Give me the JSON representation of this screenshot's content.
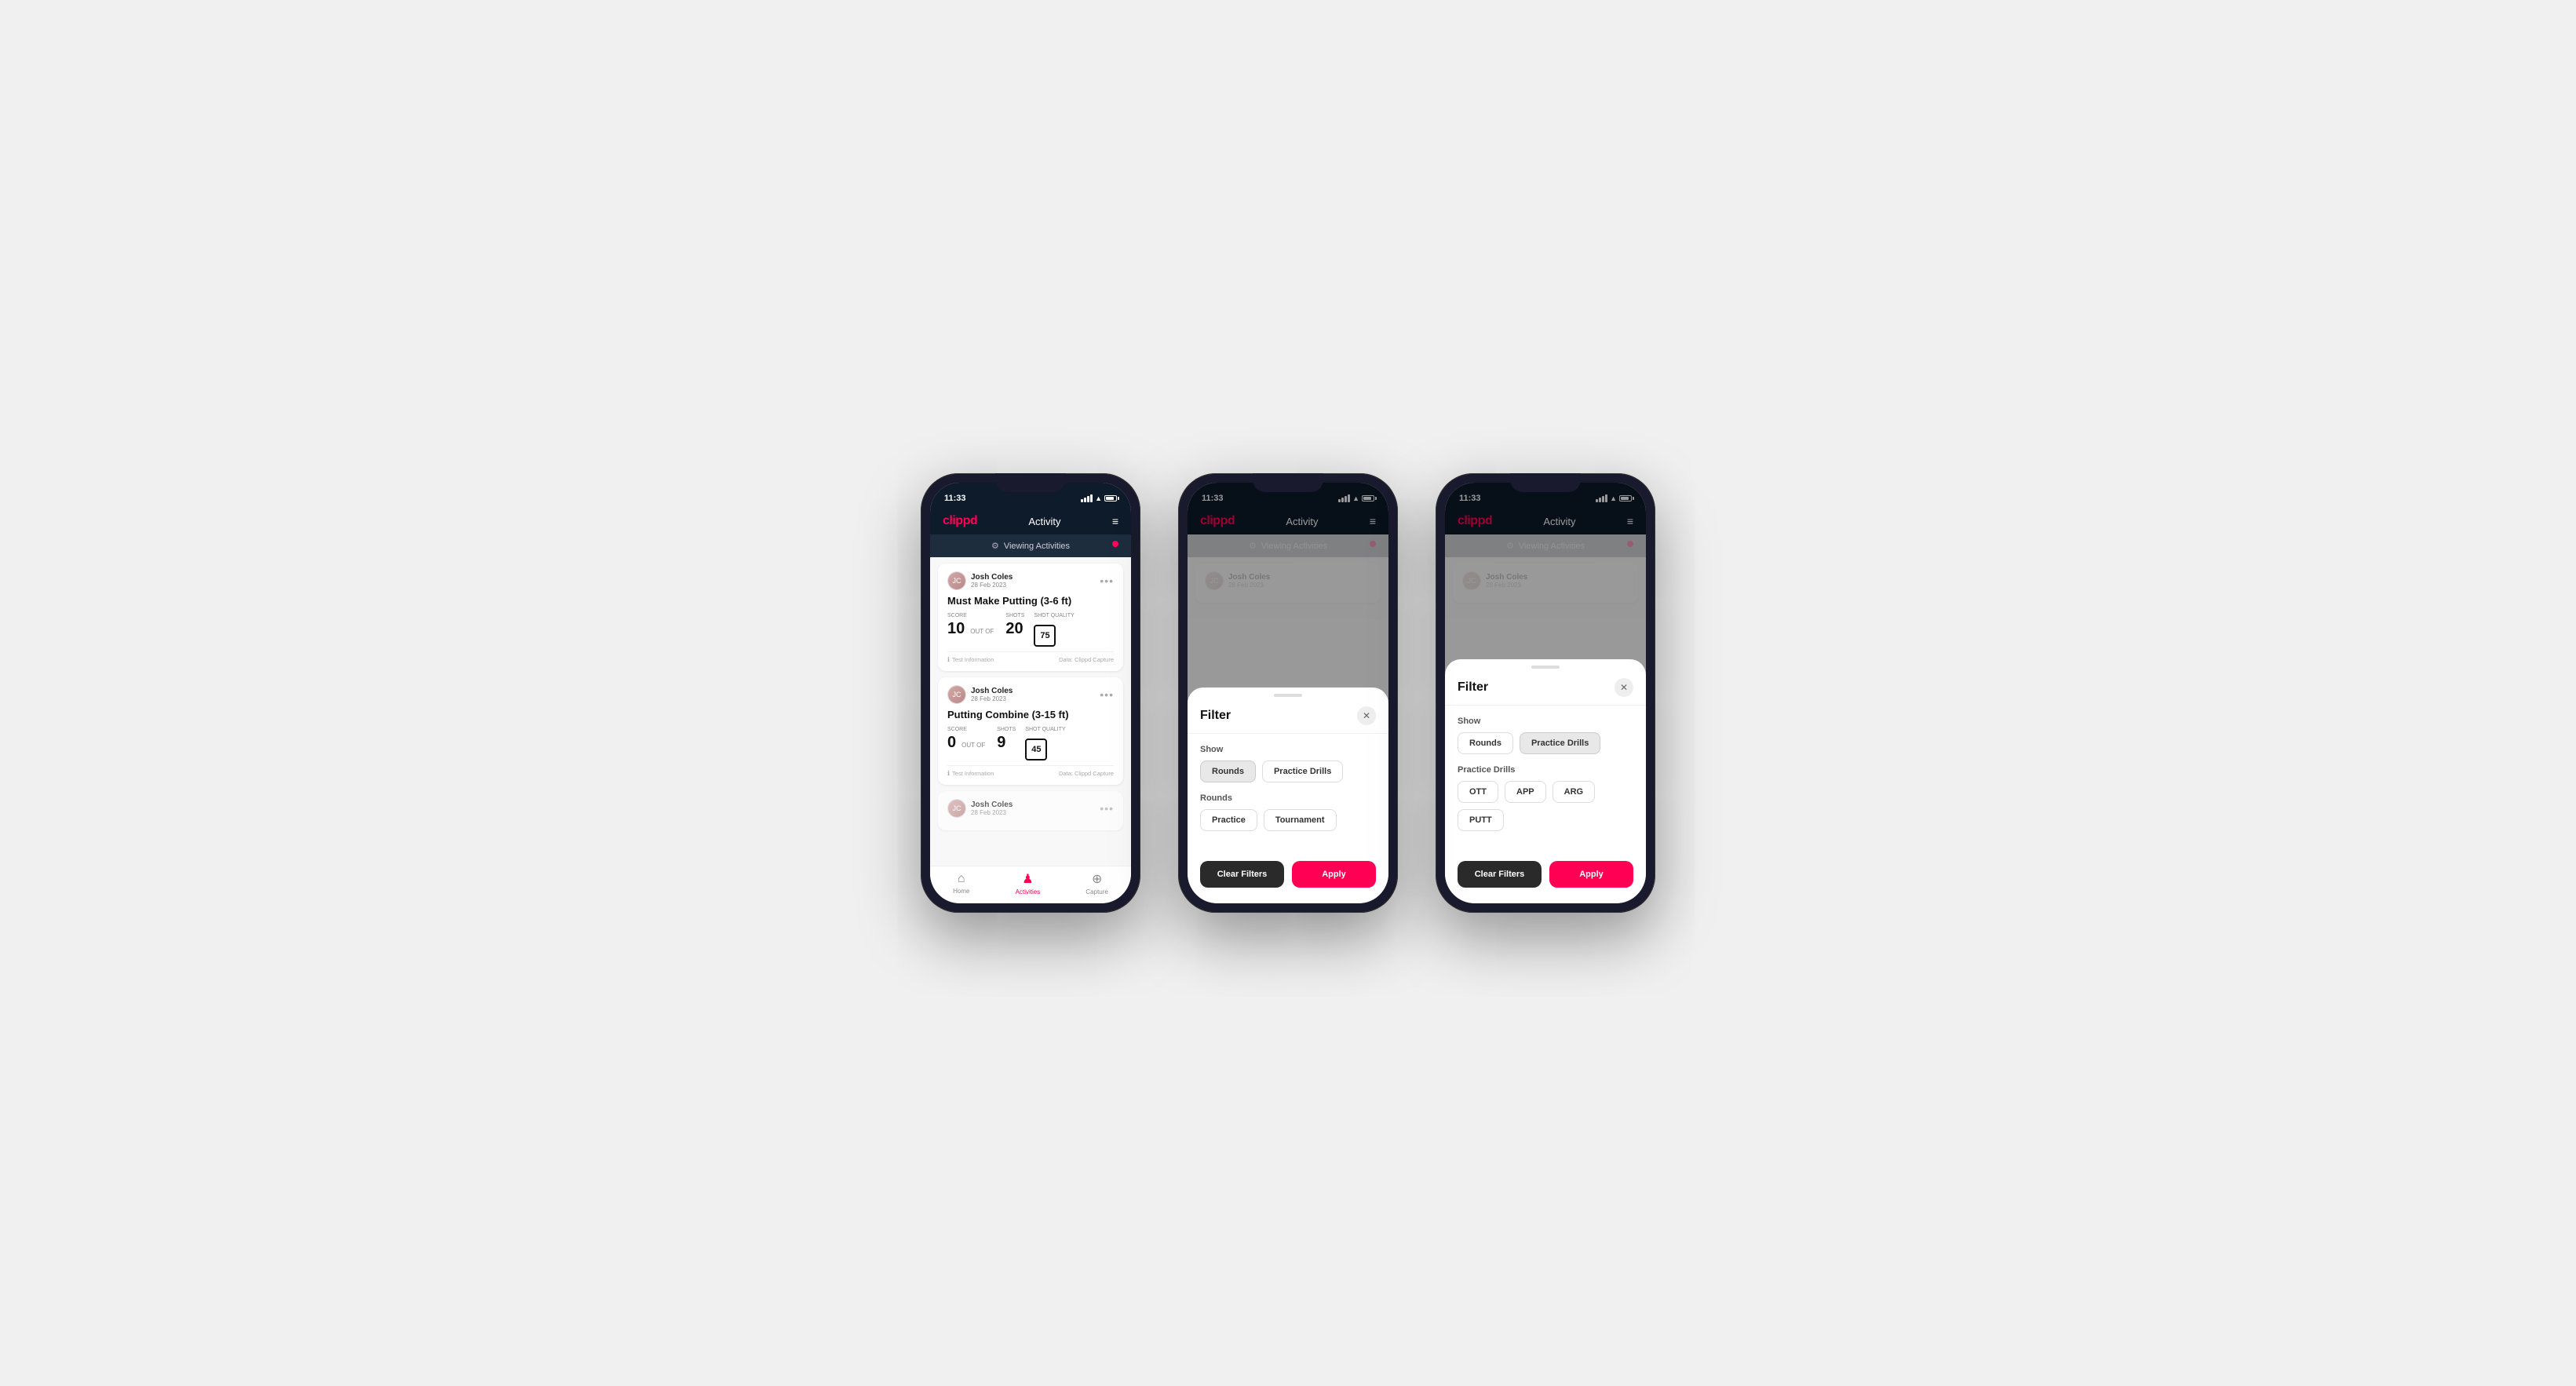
{
  "app": {
    "logo": "clippd",
    "header_title": "Activity",
    "menu_label": "≡",
    "status_time": "11:33",
    "viewing_activities": "Viewing Activities"
  },
  "phone1": {
    "activities": [
      {
        "user_name": "Josh Coles",
        "user_date": "28 Feb 2023",
        "title": "Must Make Putting (3-6 ft)",
        "score_label": "Score",
        "score_value": "10",
        "out_of": "OUT OF",
        "shots_label": "Shots",
        "shots_value": "20",
        "shot_quality_label": "Shot Quality",
        "shot_quality_value": "75",
        "footer_info": "Test Information",
        "data_source": "Data: Clippd Capture"
      },
      {
        "user_name": "Josh Coles",
        "user_date": "28 Feb 2023",
        "title": "Putting Combine (3-15 ft)",
        "score_label": "Score",
        "score_value": "0",
        "out_of": "OUT OF",
        "shots_label": "Shots",
        "shots_value": "9",
        "shot_quality_label": "Shot Quality",
        "shot_quality_value": "45",
        "footer_info": "Test Information",
        "data_source": "Data: Clippd Capture"
      }
    ],
    "nav": [
      {
        "label": "Home",
        "icon": "⌂",
        "active": false
      },
      {
        "label": "Activities",
        "icon": "♟",
        "active": true
      },
      {
        "label": "Capture",
        "icon": "⊕",
        "active": false
      }
    ]
  },
  "phone2": {
    "filter": {
      "title": "Filter",
      "show_label": "Show",
      "rounds_btn": "Rounds",
      "practice_drills_btn": "Practice Drills",
      "rounds_section_label": "Rounds",
      "practice_btn": "Practice",
      "tournament_btn": "Tournament",
      "clear_filters_btn": "Clear Filters",
      "apply_btn": "Apply",
      "active_tab": "rounds"
    }
  },
  "phone3": {
    "filter": {
      "title": "Filter",
      "show_label": "Show",
      "rounds_btn": "Rounds",
      "practice_drills_btn": "Practice Drills",
      "practice_drills_section_label": "Practice Drills",
      "ott_btn": "OTT",
      "app_btn": "APP",
      "arg_btn": "ARG",
      "putt_btn": "PUTT",
      "clear_filters_btn": "Clear Filters",
      "apply_btn": "Apply",
      "active_tab": "practice_drills"
    }
  },
  "colors": {
    "brand_red": "#ff0055",
    "dark_bg": "#0d1b2a",
    "card_border": "#ddd",
    "active_btn_bg": "#e8e8e8",
    "clear_btn_bg": "#2a2a2a"
  }
}
